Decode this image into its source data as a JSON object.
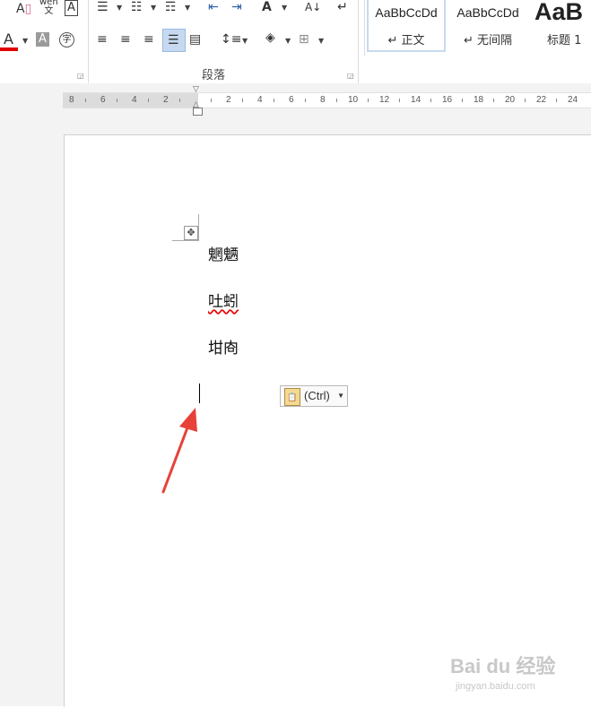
{
  "ribbon": {
    "font_group": {
      "row1_icons": [
        "clear-formatting-icon",
        "phonetic-guide-icon",
        "character-border-icon"
      ],
      "row1_glyphs": [
        "A",
        "wén\n文",
        "A"
      ],
      "row2_icons": [
        "font-color-icon",
        "character-shading-icon",
        "enclose-characters-icon"
      ],
      "row2_glyphs": [
        "A",
        "A",
        "字"
      ],
      "font_color": "#e00000"
    },
    "paragraph_group": {
      "label": "段落",
      "row1_icons": [
        "bullets-icon",
        "numbering-icon",
        "multilevel-list-icon",
        "decrease-indent-icon",
        "increase-indent-icon",
        "chinese-layout-icon",
        "sort-icon",
        "show-hide-marks-icon"
      ],
      "row2_icons": [
        "align-left-icon",
        "center-icon",
        "align-right-icon",
        "justify-icon",
        "distributed-icon",
        "line-spacing-icon",
        "shading-icon",
        "borders-icon"
      ],
      "selected_alignment": "justify"
    },
    "styles": [
      {
        "sample": "AaBbCcDd",
        "name": "↵ 正文",
        "selected": true
      },
      {
        "sample": "AaBbCcDd",
        "name": "↵ 无间隔",
        "selected": false
      },
      {
        "sample": "AaB",
        "name": "标题 1",
        "selected": false
      }
    ]
  },
  "ruler": {
    "left_ticks": [
      "8",
      "6",
      "4",
      "2"
    ],
    "right_ticks": [
      "2",
      "4",
      "6",
      "8",
      "10",
      "12",
      "14",
      "16",
      "18",
      "20",
      "22",
      "24"
    ]
  },
  "document": {
    "lines": [
      "魍魉",
      "吐蚓",
      "坩㕯"
    ],
    "misspelled_line_index": 1
  },
  "paste_options": {
    "label": "(Ctrl)",
    "icon": "clipboard-icon"
  },
  "watermark": {
    "brand": "Bai du 经验",
    "url": "jingyan.baidu.com"
  },
  "annotation": {
    "arrow_color": "#e8413a"
  }
}
